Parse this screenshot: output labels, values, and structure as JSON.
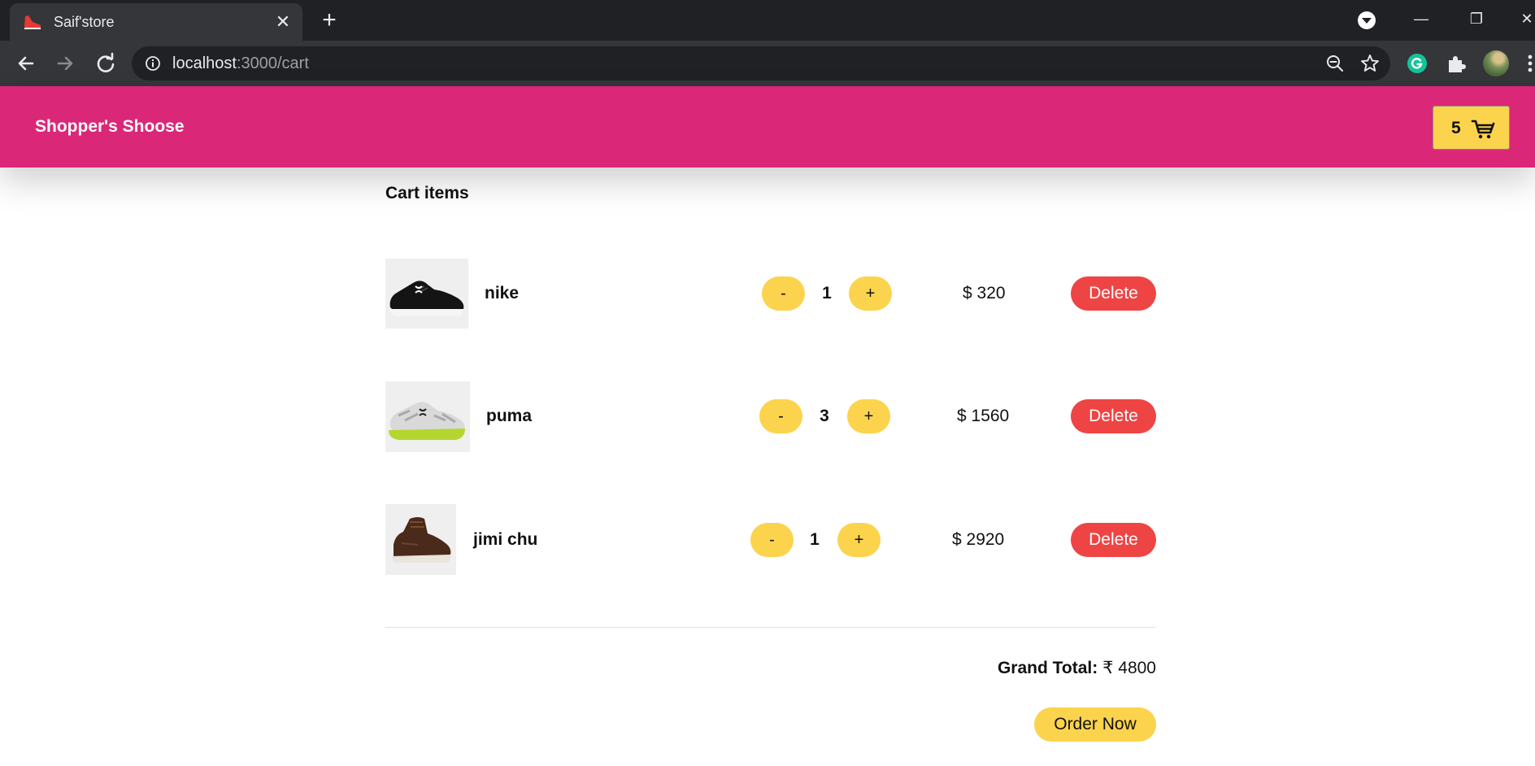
{
  "browser": {
    "tab_title": "Saif'store",
    "tab_close": "✕",
    "new_tab": "+",
    "url_host": "localhost",
    "url_path": ":3000/cart",
    "window_minimize": "—",
    "window_restore": "❐",
    "window_close": "✕",
    "colors": {
      "chrome_dark": "#202124",
      "chrome_tab": "#353639"
    }
  },
  "header": {
    "brand": "Shopper's Shoose",
    "cart_count": "5",
    "cart_icon": "shopping-cart-icon",
    "colors": {
      "background": "#db2777",
      "cart_button": "#fcd34d"
    }
  },
  "cart": {
    "title": "Cart items",
    "items": [
      {
        "name": "nike",
        "decrement": "-",
        "quantity": "1",
        "increment": "+",
        "price": "$ 320",
        "delete": "Delete"
      },
      {
        "name": "puma",
        "decrement": "-",
        "quantity": "3",
        "increment": "+",
        "price": "$ 1560",
        "delete": "Delete"
      },
      {
        "name": "jimi chu",
        "decrement": "-",
        "quantity": "1",
        "increment": "+",
        "price": "$ 2920",
        "delete": "Delete"
      }
    ],
    "grand_total_label": "Grand Total:",
    "grand_total_value": "₹ 4800",
    "order_button": "Order Now",
    "colors": {
      "qty_button": "#fcd34d",
      "delete_button": "#ef4444"
    }
  }
}
